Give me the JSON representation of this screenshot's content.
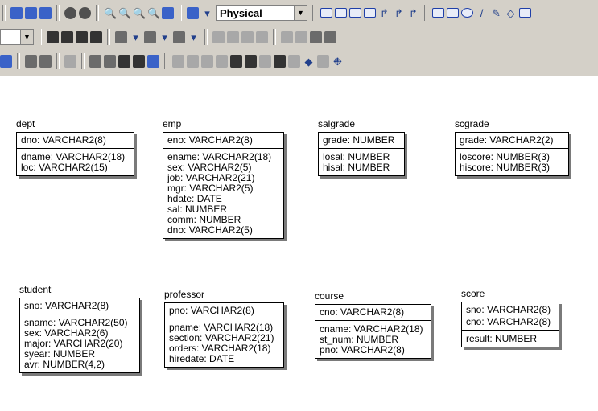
{
  "toolbar": {
    "notation_select": {
      "value": "Physical"
    }
  },
  "entities": [
    {
      "id": "dept",
      "name": "dept",
      "keys": [
        "dno: VARCHAR2(8)"
      ],
      "attrs": [
        "dname: VARCHAR2(18)",
        "loc: VARCHAR2(15)"
      ]
    },
    {
      "id": "emp",
      "name": "emp",
      "keys": [
        "eno: VARCHAR2(8)"
      ],
      "attrs": [
        "ename: VARCHAR2(18)",
        "sex: VARCHAR2(5)",
        "job: VARCHAR2(21)",
        "mgr: VARCHAR2(5)",
        "hdate: DATE",
        "sal: NUMBER",
        "comm: NUMBER",
        "dno: VARCHAR2(5)"
      ]
    },
    {
      "id": "salgrade",
      "name": "salgrade",
      "keys": [
        "grade: NUMBER"
      ],
      "attrs": [
        "losal: NUMBER",
        "hisal: NUMBER"
      ]
    },
    {
      "id": "scgrade",
      "name": "scgrade",
      "keys": [
        "grade: VARCHAR2(2)"
      ],
      "attrs": [
        "loscore: NUMBER(3)",
        "hiscore: NUMBER(3)"
      ]
    },
    {
      "id": "student",
      "name": "student",
      "keys": [
        "sno: VARCHAR2(8)"
      ],
      "attrs": [
        "sname: VARCHAR2(50)",
        "sex: VARCHAR2(6)",
        "major: VARCHAR2(20)",
        "syear: NUMBER",
        "avr: NUMBER(4,2)"
      ]
    },
    {
      "id": "professor",
      "name": "professor",
      "keys": [
        "pno: VARCHAR2(8)"
      ],
      "attrs": [
        "pname: VARCHAR2(18)",
        "section: VARCHAR2(21)",
        "orders: VARCHAR2(18)",
        "hiredate: DATE"
      ]
    },
    {
      "id": "course",
      "name": "course",
      "keys": [
        "cno: VARCHAR2(8)"
      ],
      "attrs": [
        "cname: VARCHAR2(18)",
        "st_num: NUMBER",
        "pno: VARCHAR2(8)"
      ]
    },
    {
      "id": "score",
      "name": "score",
      "keys": [
        "sno: VARCHAR2(8)",
        "cno: VARCHAR2(8)"
      ],
      "attrs": [
        "result: NUMBER"
      ]
    }
  ]
}
